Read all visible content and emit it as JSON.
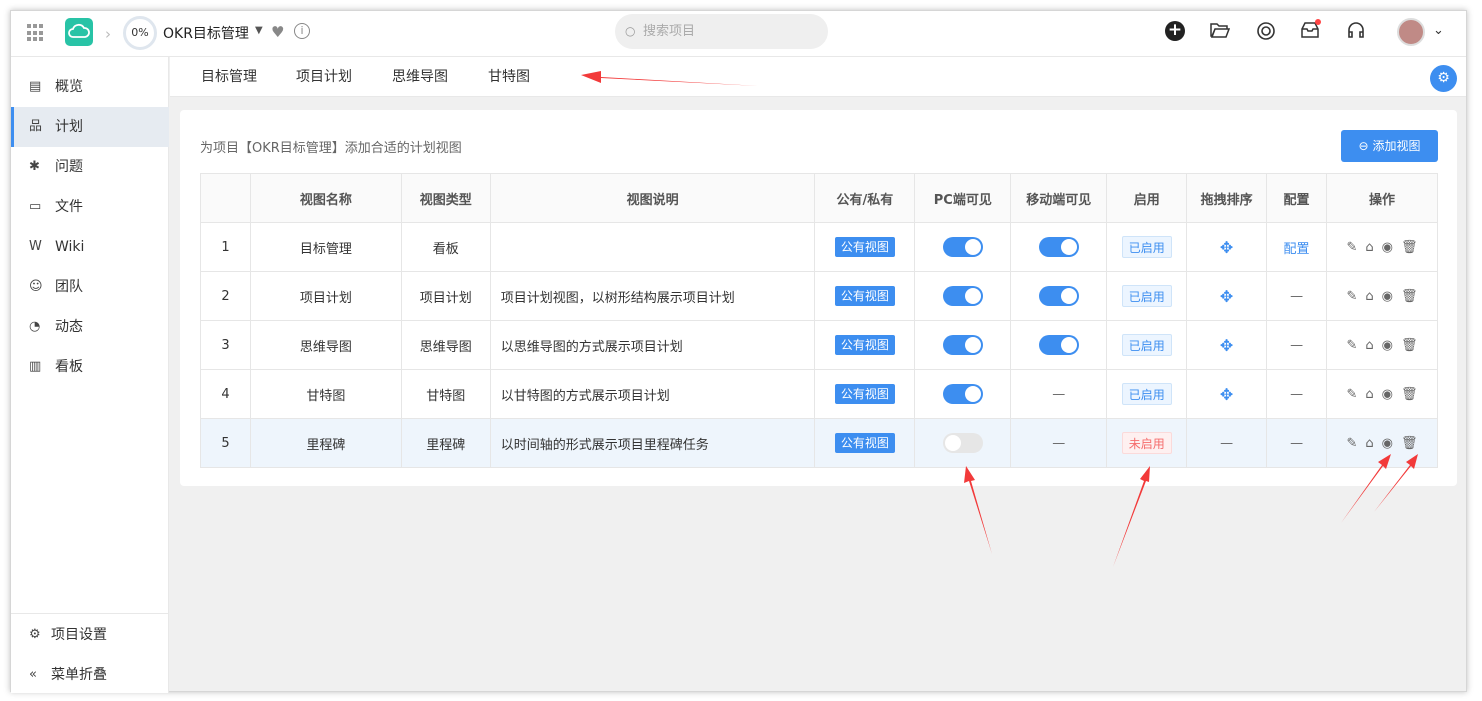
{
  "header": {
    "progress": "0%",
    "project_title": "OKR目标管理",
    "search_placeholder": "搜索项目"
  },
  "sidebar": {
    "items": [
      {
        "label": "概览",
        "icon": "overview-icon"
      },
      {
        "label": "计划",
        "icon": "plan-icon",
        "active": true
      },
      {
        "label": "问题",
        "icon": "bug-icon"
      },
      {
        "label": "文件",
        "icon": "folder-icon"
      },
      {
        "label": "Wiki",
        "icon": "wiki-icon"
      },
      {
        "label": "团队",
        "icon": "team-icon"
      },
      {
        "label": "动态",
        "icon": "activity-icon"
      },
      {
        "label": "看板",
        "icon": "chart-icon"
      }
    ],
    "settings": "项目设置",
    "collapse": "菜单折叠"
  },
  "tabs": [
    "目标管理",
    "项目计划",
    "思维导图",
    "甘特图"
  ],
  "card": {
    "description": "为项目【OKR目标管理】添加合适的计划视图",
    "add_button": "添加视图"
  },
  "table": {
    "headers": [
      "",
      "视图名称",
      "视图类型",
      "视图说明",
      "公有/私有",
      "PC端可见",
      "移动端可见",
      "启用",
      "拖拽排序",
      "配置",
      "操作"
    ],
    "rows": [
      {
        "index": "1",
        "name": "目标管理",
        "type": "看板",
        "desc": "",
        "visibility": "公有视图",
        "pc": true,
        "mobile": "on",
        "status": "已启用",
        "enabled": true,
        "sort": true,
        "config": "配置"
      },
      {
        "index": "2",
        "name": "项目计划",
        "type": "项目计划",
        "desc": "项目计划视图，以树形结构展示项目计划",
        "visibility": "公有视图",
        "pc": true,
        "mobile": "on",
        "status": "已启用",
        "enabled": true,
        "sort": true,
        "config": "—"
      },
      {
        "index": "3",
        "name": "思维导图",
        "type": "思维导图",
        "desc": "以思维导图的方式展示项目计划",
        "visibility": "公有视图",
        "pc": true,
        "mobile": "on",
        "status": "已启用",
        "enabled": true,
        "sort": true,
        "config": "—"
      },
      {
        "index": "4",
        "name": "甘特图",
        "type": "甘特图",
        "desc": "以甘特图的方式展示项目计划",
        "visibility": "公有视图",
        "pc": true,
        "mobile": "—",
        "status": "已启用",
        "enabled": true,
        "sort": true,
        "config": "—"
      },
      {
        "index": "5",
        "name": "里程碑",
        "type": "里程碑",
        "desc": "以时间轴的形式展示项目里程碑任务",
        "visibility": "公有视图",
        "pc": false,
        "mobile": "—",
        "status": "未启用",
        "enabled": false,
        "sort": false,
        "config": "—"
      }
    ]
  }
}
